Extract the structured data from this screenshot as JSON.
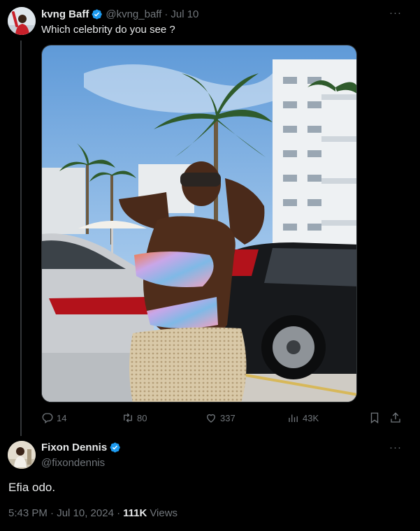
{
  "tweet": {
    "author_name": "kvng Baff",
    "handle": "@kvng_baff",
    "separator": "·",
    "date": "Jul 10",
    "text": "Which celebrity do you see ?",
    "more": "···",
    "stats": {
      "replies": "14",
      "retweets": "80",
      "likes": "337",
      "views": "43K"
    }
  },
  "reply": {
    "author_name": "Fixon Dennis",
    "handle": "@fixondennis",
    "text": "Efia odo.",
    "more": "···",
    "time": "5:43 PM · Jul 10, 2024 ·",
    "views_count": "111K",
    "views_label": "Views"
  },
  "icons": {
    "verified": "verified-badge-icon",
    "reply": "reply-icon",
    "retweet": "retweet-icon",
    "like": "heart-icon",
    "views": "analytics-icon",
    "bookmark": "bookmark-icon",
    "share": "share-icon"
  },
  "colors": {
    "background": "#000000",
    "text": "#e7e9ea",
    "muted": "#71767b",
    "verified": "#1d9bf0",
    "border": "#2f3336"
  }
}
